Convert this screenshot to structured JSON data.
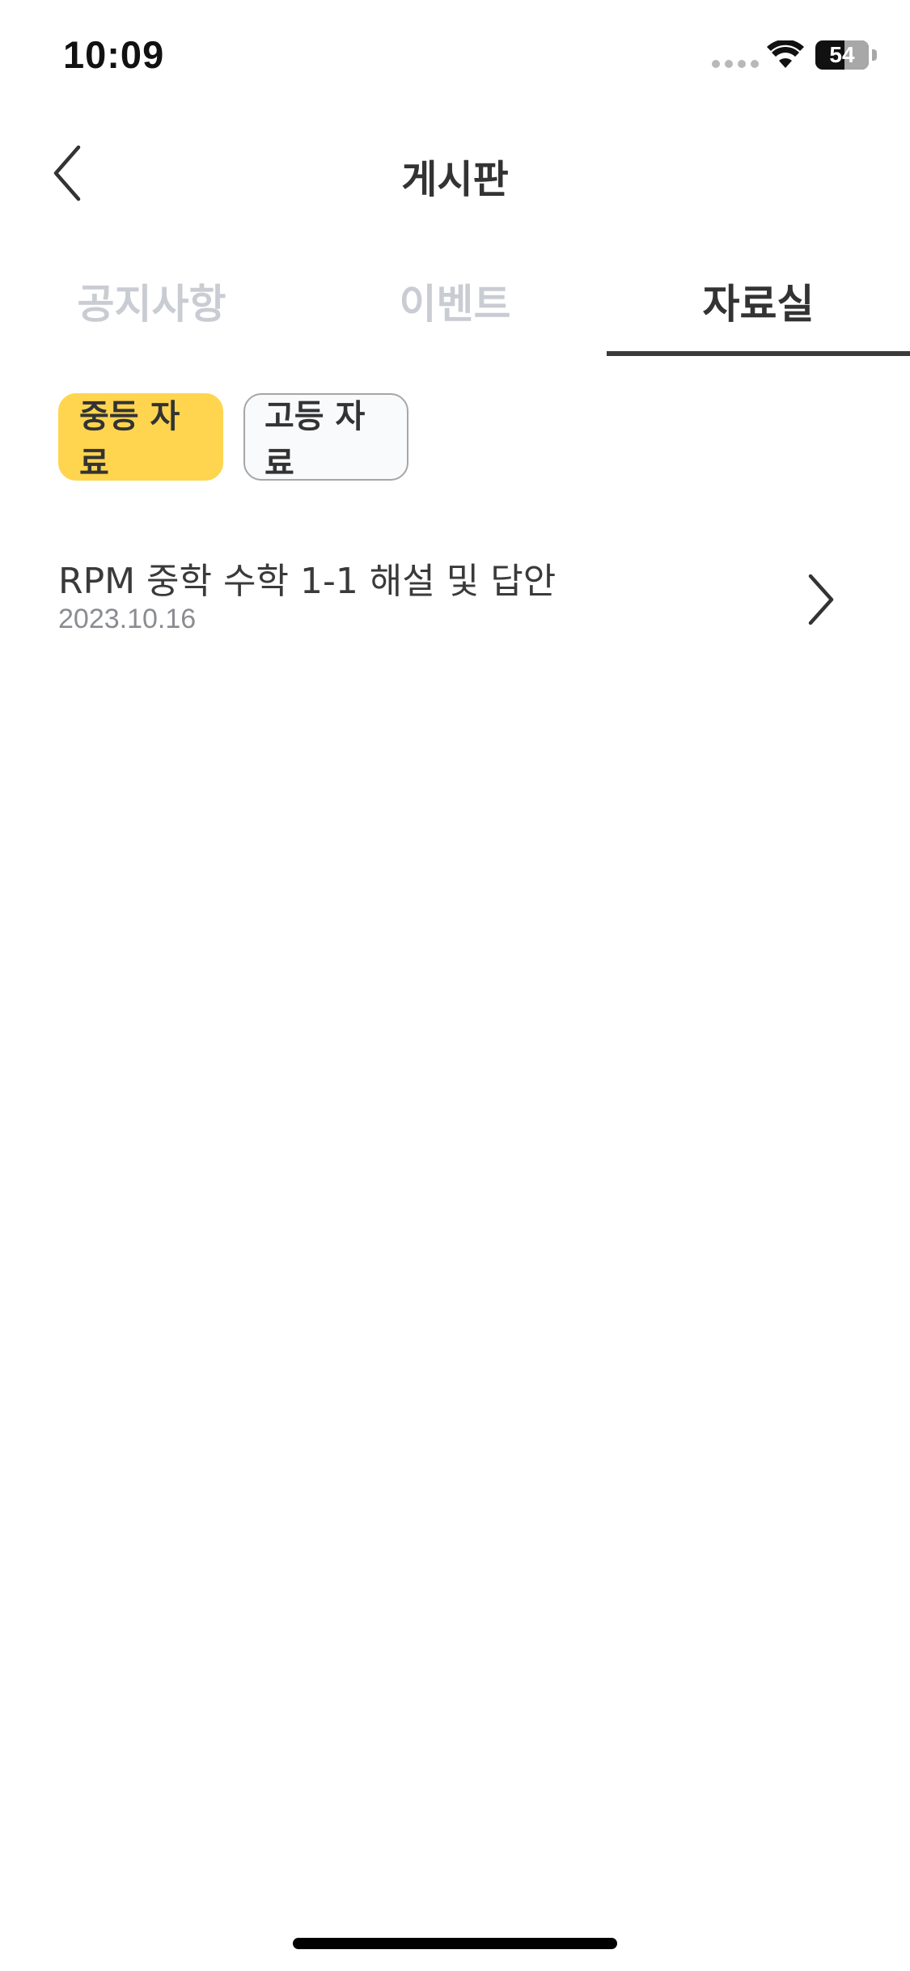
{
  "status_bar": {
    "time": "10:09",
    "battery": "54",
    "icons": [
      "signal-dots-icon",
      "wifi-icon",
      "battery-icon"
    ]
  },
  "header": {
    "title": "게시판",
    "back_icon": "chevron-left-icon"
  },
  "tabs": [
    {
      "label": "공지사항",
      "active": false
    },
    {
      "label": "이벤트",
      "active": false
    },
    {
      "label": "자료실",
      "active": true
    }
  ],
  "filters": [
    {
      "label": "중등 자료",
      "selected": true
    },
    {
      "label": "고등 자료",
      "selected": false
    }
  ],
  "list": [
    {
      "title": "RPM 중학 수학 1-1 해설 및 답안",
      "date": "2023.10.16",
      "icon": "chevron-right-icon"
    }
  ],
  "colors": {
    "accent": "#ffd54f",
    "tab_active": "#333333",
    "tab_inactive": "#c9ccd3",
    "date_text": "#8a8c91"
  }
}
